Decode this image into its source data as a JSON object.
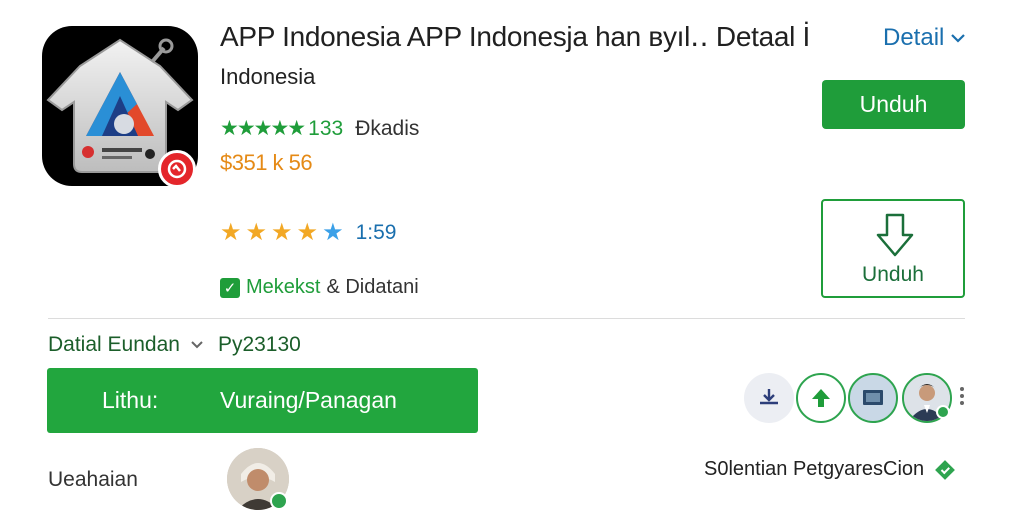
{
  "header": {
    "title": "APP Indonesia APP Indonesja han ʙyıl‥ Detaal İ",
    "detail_link": "Detail",
    "subtitle": "Indonesia"
  },
  "rating": {
    "stars_text": "★★★★★",
    "count": "133",
    "label": "Ðkadis"
  },
  "price": "$351 k 56",
  "stars_row": {
    "value": "1:59",
    "filled": 4
  },
  "check": {
    "green_text": "Mekekst",
    "rest_text": "& Didatani"
  },
  "buttons": {
    "unduh_primary": "Unduh",
    "unduh_outline": "Unduh"
  },
  "detail_row": {
    "label": "Datial Eundan",
    "code": "Py23130"
  },
  "big_bar": {
    "left": "Lithu:",
    "right": "Vuraing/Panagan"
  },
  "action_icons": [
    "download-tray-icon",
    "upload-arrow-icon",
    "screen-icon",
    "profile-avatar"
  ],
  "bottom": {
    "left_label": "Ueahaian",
    "right_label": "S0lentian PetgyaresCion"
  },
  "colors": {
    "accent_green": "#1f9d3a",
    "link_blue": "#1a6fae",
    "price_orange": "#e58a16",
    "badge_red": "#e4262b"
  }
}
